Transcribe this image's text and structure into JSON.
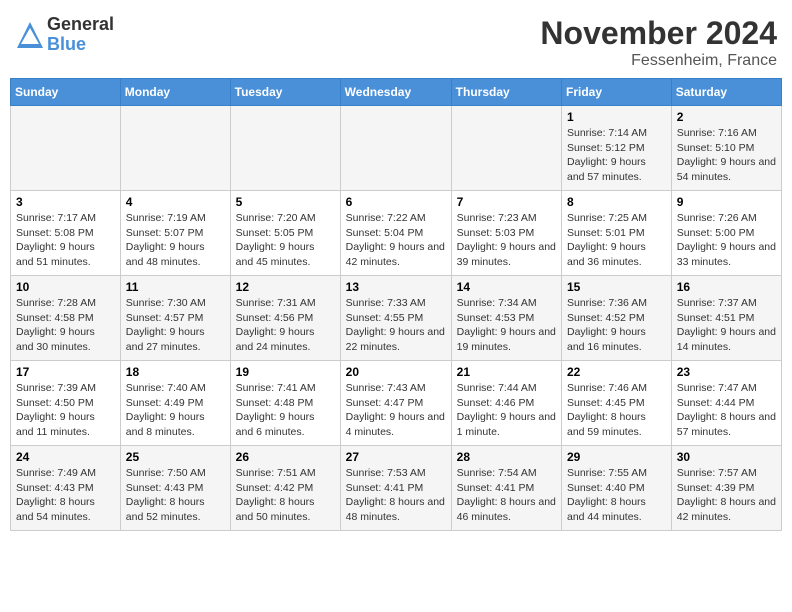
{
  "header": {
    "logo_general": "General",
    "logo_blue": "Blue",
    "month_title": "November 2024",
    "location": "Fessenheim, France"
  },
  "weekdays": [
    "Sunday",
    "Monday",
    "Tuesday",
    "Wednesday",
    "Thursday",
    "Friday",
    "Saturday"
  ],
  "weeks": [
    [
      {
        "day": "",
        "info": ""
      },
      {
        "day": "",
        "info": ""
      },
      {
        "day": "",
        "info": ""
      },
      {
        "day": "",
        "info": ""
      },
      {
        "day": "",
        "info": ""
      },
      {
        "day": "1",
        "info": "Sunrise: 7:14 AM\nSunset: 5:12 PM\nDaylight: 9 hours and 57 minutes."
      },
      {
        "day": "2",
        "info": "Sunrise: 7:16 AM\nSunset: 5:10 PM\nDaylight: 9 hours and 54 minutes."
      }
    ],
    [
      {
        "day": "3",
        "info": "Sunrise: 7:17 AM\nSunset: 5:08 PM\nDaylight: 9 hours and 51 minutes."
      },
      {
        "day": "4",
        "info": "Sunrise: 7:19 AM\nSunset: 5:07 PM\nDaylight: 9 hours and 48 minutes."
      },
      {
        "day": "5",
        "info": "Sunrise: 7:20 AM\nSunset: 5:05 PM\nDaylight: 9 hours and 45 minutes."
      },
      {
        "day": "6",
        "info": "Sunrise: 7:22 AM\nSunset: 5:04 PM\nDaylight: 9 hours and 42 minutes."
      },
      {
        "day": "7",
        "info": "Sunrise: 7:23 AM\nSunset: 5:03 PM\nDaylight: 9 hours and 39 minutes."
      },
      {
        "day": "8",
        "info": "Sunrise: 7:25 AM\nSunset: 5:01 PM\nDaylight: 9 hours and 36 minutes."
      },
      {
        "day": "9",
        "info": "Sunrise: 7:26 AM\nSunset: 5:00 PM\nDaylight: 9 hours and 33 minutes."
      }
    ],
    [
      {
        "day": "10",
        "info": "Sunrise: 7:28 AM\nSunset: 4:58 PM\nDaylight: 9 hours and 30 minutes."
      },
      {
        "day": "11",
        "info": "Sunrise: 7:30 AM\nSunset: 4:57 PM\nDaylight: 9 hours and 27 minutes."
      },
      {
        "day": "12",
        "info": "Sunrise: 7:31 AM\nSunset: 4:56 PM\nDaylight: 9 hours and 24 minutes."
      },
      {
        "day": "13",
        "info": "Sunrise: 7:33 AM\nSunset: 4:55 PM\nDaylight: 9 hours and 22 minutes."
      },
      {
        "day": "14",
        "info": "Sunrise: 7:34 AM\nSunset: 4:53 PM\nDaylight: 9 hours and 19 minutes."
      },
      {
        "day": "15",
        "info": "Sunrise: 7:36 AM\nSunset: 4:52 PM\nDaylight: 9 hours and 16 minutes."
      },
      {
        "day": "16",
        "info": "Sunrise: 7:37 AM\nSunset: 4:51 PM\nDaylight: 9 hours and 14 minutes."
      }
    ],
    [
      {
        "day": "17",
        "info": "Sunrise: 7:39 AM\nSunset: 4:50 PM\nDaylight: 9 hours and 11 minutes."
      },
      {
        "day": "18",
        "info": "Sunrise: 7:40 AM\nSunset: 4:49 PM\nDaylight: 9 hours and 8 minutes."
      },
      {
        "day": "19",
        "info": "Sunrise: 7:41 AM\nSunset: 4:48 PM\nDaylight: 9 hours and 6 minutes."
      },
      {
        "day": "20",
        "info": "Sunrise: 7:43 AM\nSunset: 4:47 PM\nDaylight: 9 hours and 4 minutes."
      },
      {
        "day": "21",
        "info": "Sunrise: 7:44 AM\nSunset: 4:46 PM\nDaylight: 9 hours and 1 minute."
      },
      {
        "day": "22",
        "info": "Sunrise: 7:46 AM\nSunset: 4:45 PM\nDaylight: 8 hours and 59 minutes."
      },
      {
        "day": "23",
        "info": "Sunrise: 7:47 AM\nSunset: 4:44 PM\nDaylight: 8 hours and 57 minutes."
      }
    ],
    [
      {
        "day": "24",
        "info": "Sunrise: 7:49 AM\nSunset: 4:43 PM\nDaylight: 8 hours and 54 minutes."
      },
      {
        "day": "25",
        "info": "Sunrise: 7:50 AM\nSunset: 4:43 PM\nDaylight: 8 hours and 52 minutes."
      },
      {
        "day": "26",
        "info": "Sunrise: 7:51 AM\nSunset: 4:42 PM\nDaylight: 8 hours and 50 minutes."
      },
      {
        "day": "27",
        "info": "Sunrise: 7:53 AM\nSunset: 4:41 PM\nDaylight: 8 hours and 48 minutes."
      },
      {
        "day": "28",
        "info": "Sunrise: 7:54 AM\nSunset: 4:41 PM\nDaylight: 8 hours and 46 minutes."
      },
      {
        "day": "29",
        "info": "Sunrise: 7:55 AM\nSunset: 4:40 PM\nDaylight: 8 hours and 44 minutes."
      },
      {
        "day": "30",
        "info": "Sunrise: 7:57 AM\nSunset: 4:39 PM\nDaylight: 8 hours and 42 minutes."
      }
    ]
  ]
}
